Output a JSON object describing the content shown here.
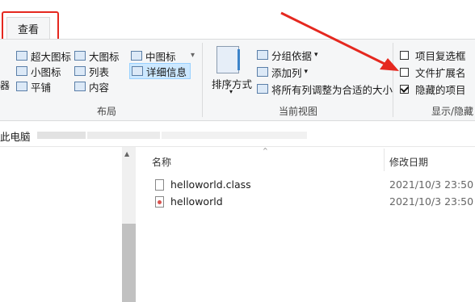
{
  "tabs": {
    "view": "查看"
  },
  "layout_group": {
    "label": "布局",
    "items": [
      "超大图标",
      "大图标",
      "中图标",
      "小图标",
      "列表",
      "详细信息",
      "平铺",
      "内容"
    ]
  },
  "current_view_group": {
    "label": "当前视图",
    "sort_label": "排序方式",
    "group_by": "分组依据",
    "add_column": "添加列",
    "fit_columns": "将所有列调整为合适的大小"
  },
  "show_hide_group": {
    "label": "显示/隐藏",
    "item_checkboxes": {
      "label": "项目复选框",
      "checked": false
    },
    "file_extensions": {
      "label": "文件扩展名",
      "checked": false
    },
    "hidden_items": {
      "label": "隐藏的项目",
      "checked": true
    }
  },
  "left_edge_fragment": "器",
  "address_bar": {
    "path_first": "此电脑"
  },
  "columns": {
    "name": "名称",
    "date_modified": "修改日期"
  },
  "files": [
    {
      "name": "helloworld.class",
      "date": "2021/10/3 23:50",
      "icon": "file-icon"
    },
    {
      "name": "helloworld",
      "date": "2021/10/3 23:50",
      "icon": "java-file-icon"
    }
  ],
  "colors": {
    "highlight_red": "#e5281f",
    "ribbon_bg": "#f5f6f7",
    "selection": "#cce8ff"
  }
}
